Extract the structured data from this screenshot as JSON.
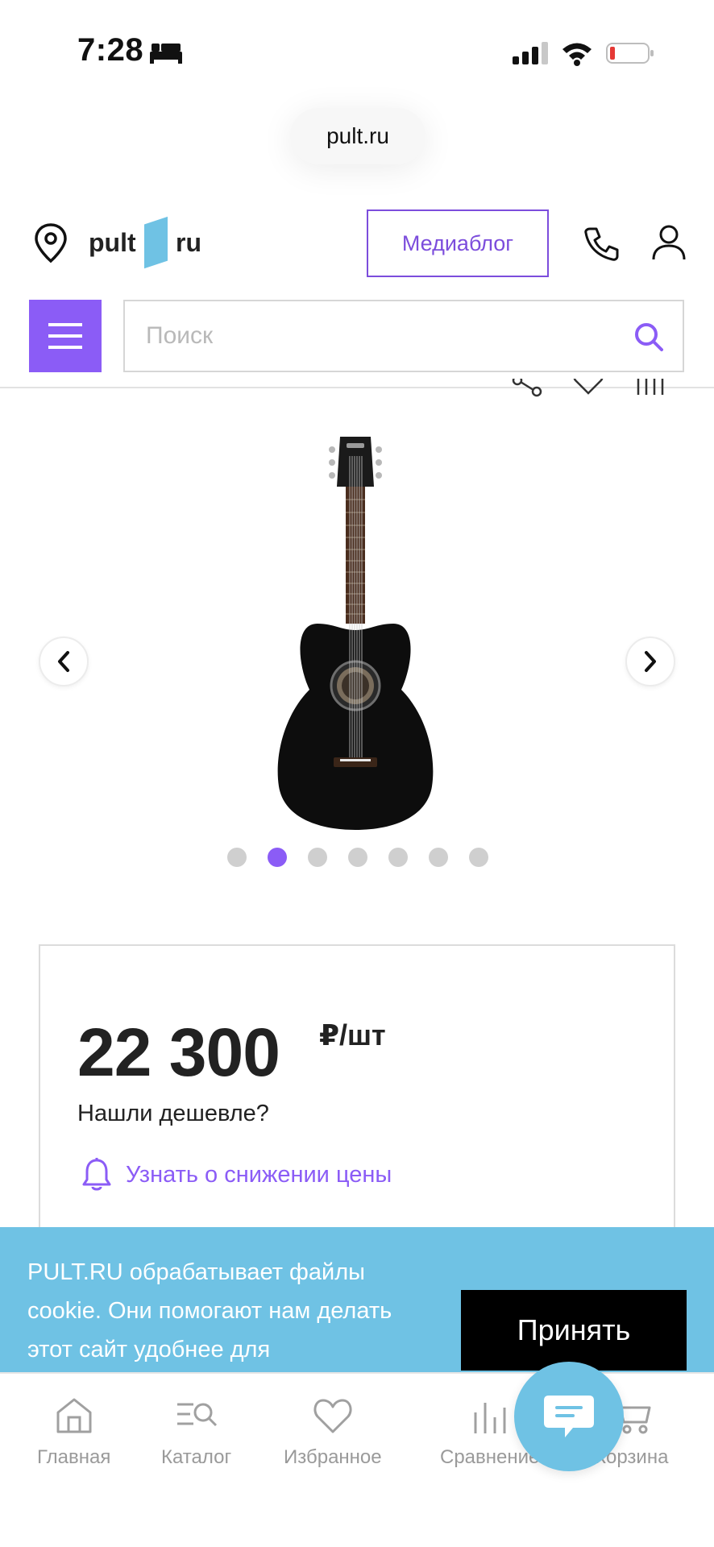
{
  "status_bar": {
    "time": "7:28",
    "battery_color": "#e53935"
  },
  "browser": {
    "url": "pult.ru"
  },
  "header": {
    "logo_left": "pult",
    "logo_right": "ru",
    "logo_color": "#6fc2e4",
    "mediablog_label": "Медиаблог"
  },
  "search": {
    "placeholder": "Поиск"
  },
  "product": {
    "image_name": "acoustic-guitar-black",
    "gallery": {
      "slides_count": 7,
      "active_slide": 2
    }
  },
  "price": {
    "value": "22 300",
    "unit": "₽/шт",
    "cheaper_label": "Нашли дешевле?",
    "notify_label": "Узнать о снижении цены"
  },
  "cookie": {
    "text": "PULT.RU обрабатывает файлы cookie. Они помогают нам делать этот сайт удобнее для",
    "accept_label": "Принять"
  },
  "nav": {
    "items": [
      {
        "label": "Главная",
        "icon": "home-icon"
      },
      {
        "label": "Каталог",
        "icon": "catalog-icon"
      },
      {
        "label": "Избранное",
        "icon": "heart-icon"
      },
      {
        "label": "Сравнение",
        "icon": "compare-icon"
      },
      {
        "label": "Корзина",
        "icon": "cart-icon"
      }
    ]
  },
  "colors": {
    "accent": "#8b5cf6",
    "banner": "#6fc2e4"
  }
}
